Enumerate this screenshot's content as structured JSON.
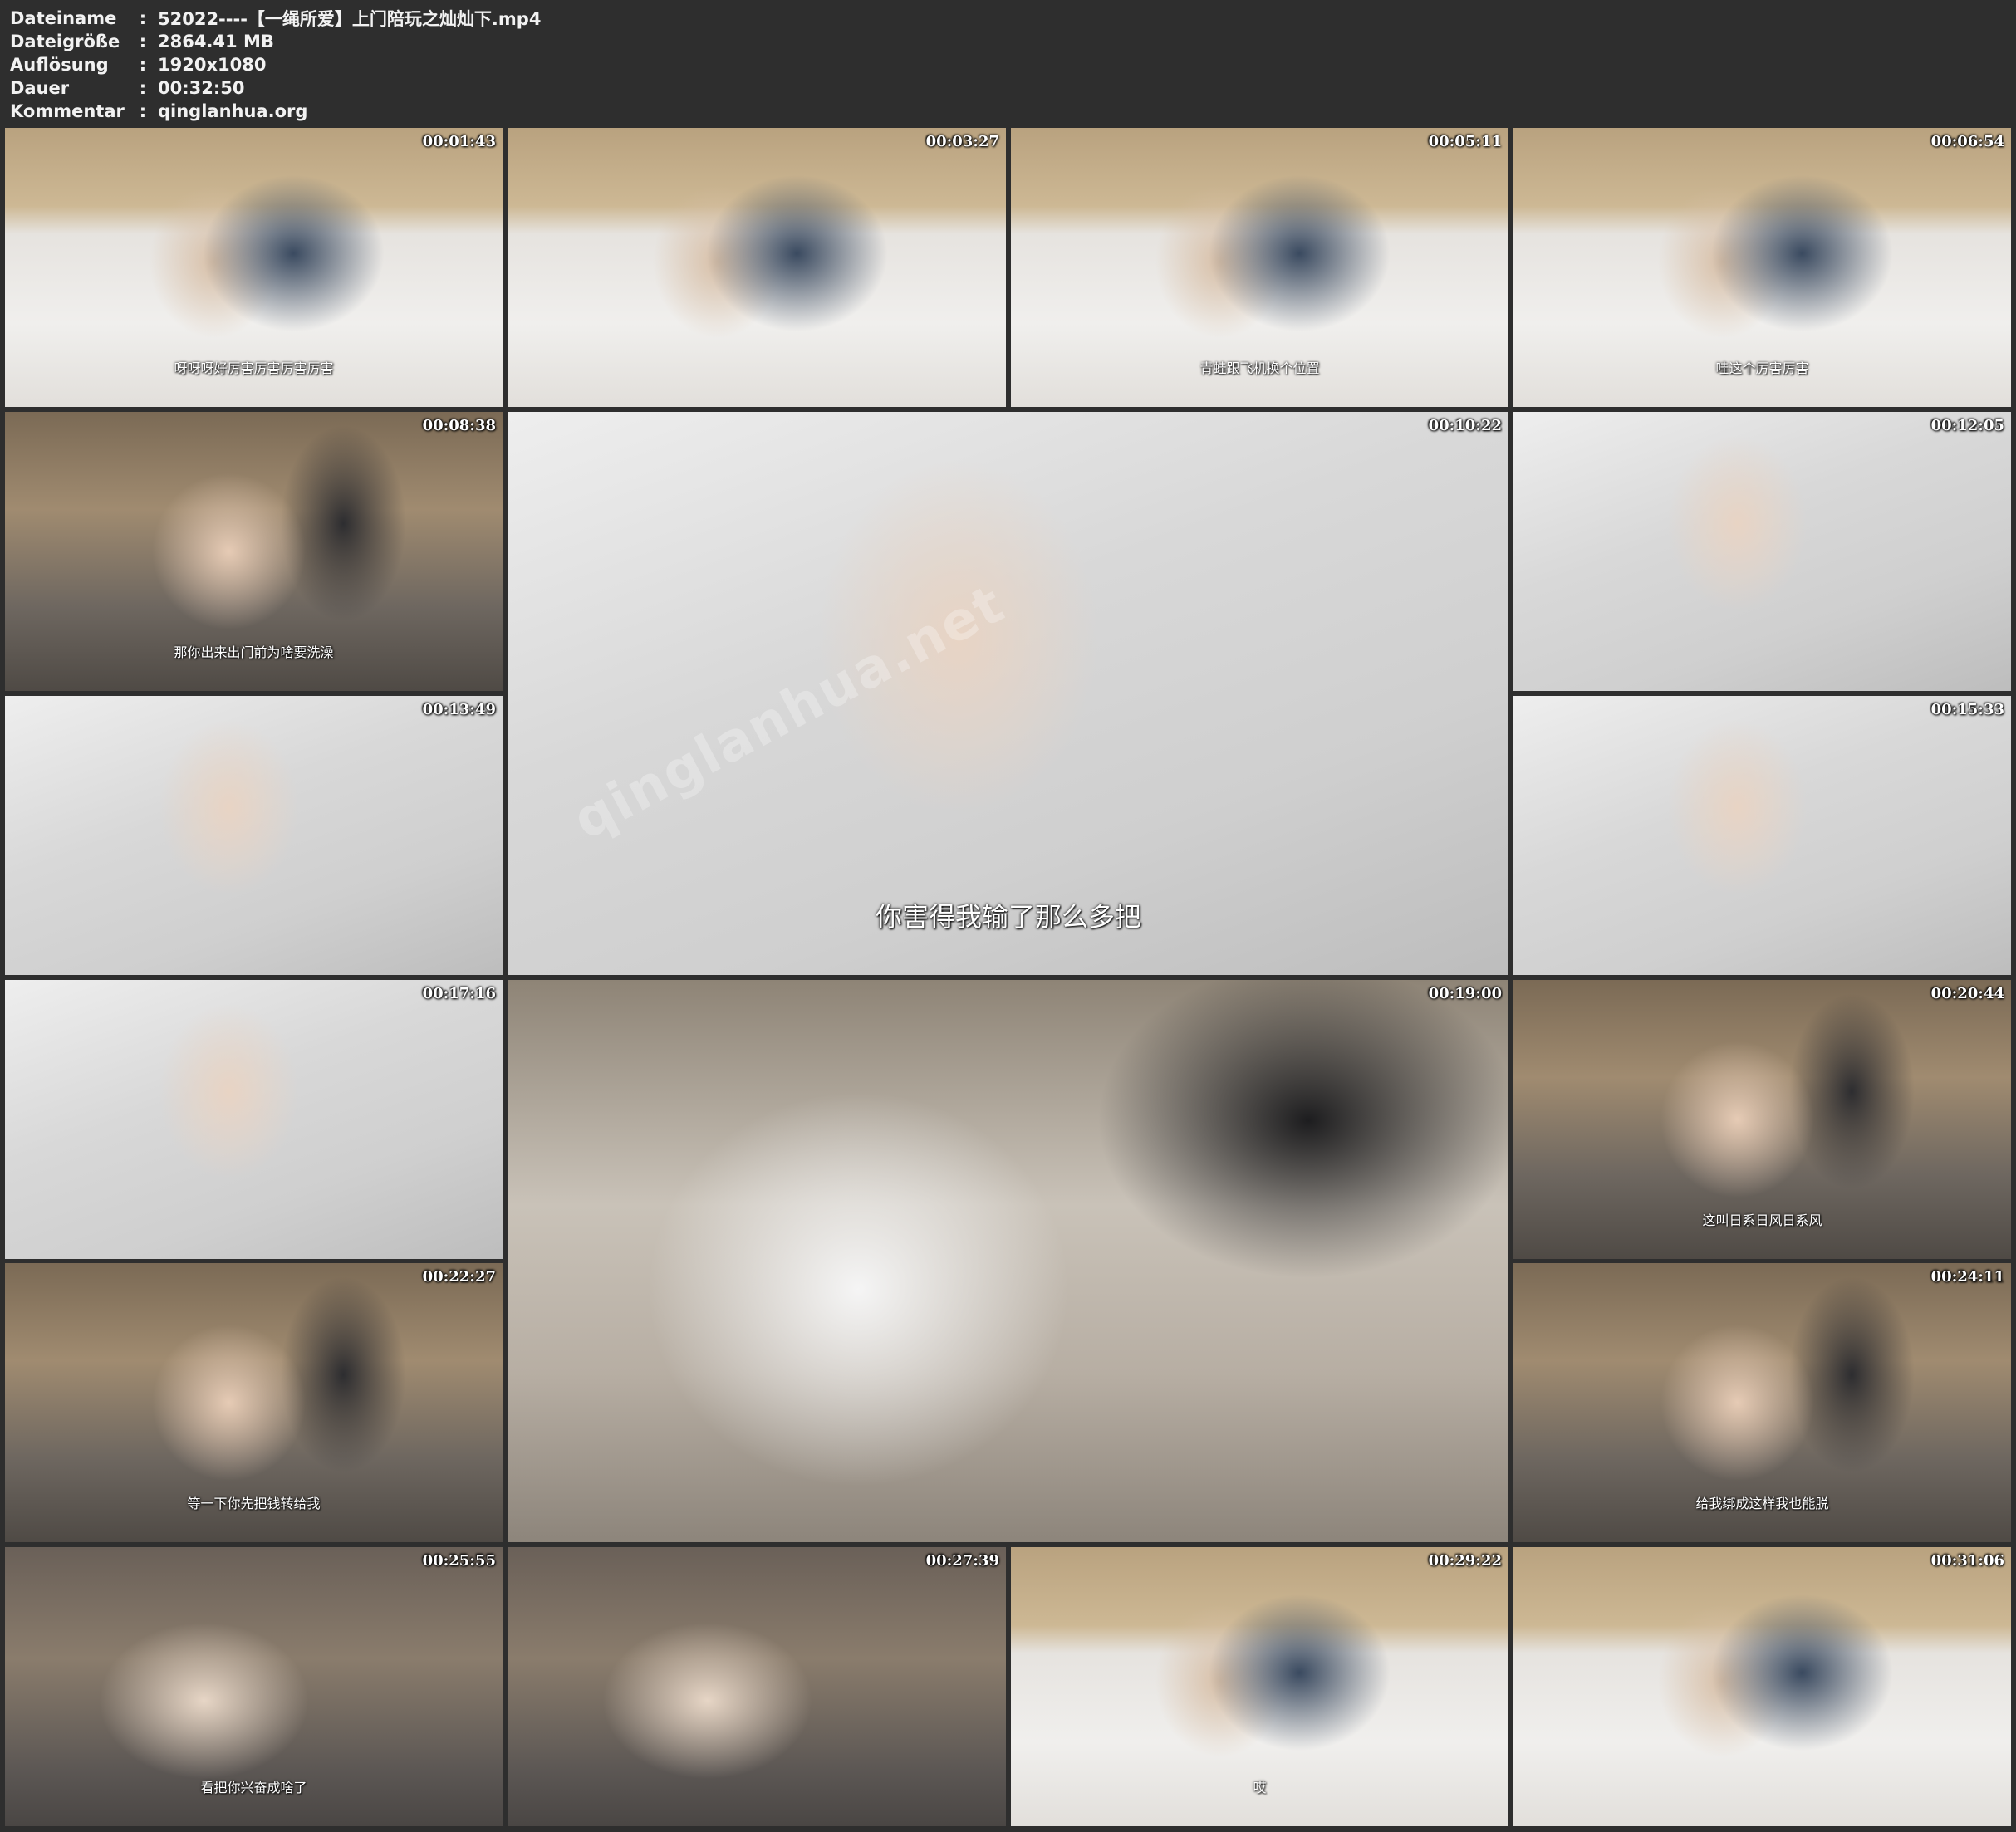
{
  "header": {
    "rows": [
      {
        "label": "Dateiname",
        "value": "52022----【一绳所爱】上门陪玩之灿灿下.mp4"
      },
      {
        "label": "Dateigröße",
        "value": "2864.41 MB"
      },
      {
        "label": "Auflösung",
        "value": "1920x1080"
      },
      {
        "label": "Dauer",
        "value": "00:32:50"
      },
      {
        "label": "Kommentar",
        "value": "qinglanhua.org"
      }
    ],
    "separator": ":"
  },
  "watermark": "qinglanhua.net",
  "thumbnails": [
    {
      "time": "00:01:43",
      "subtitle": "呀呀呀好厉害厉害厉害厉害",
      "scene": "bed"
    },
    {
      "time": "00:03:27",
      "subtitle": "",
      "scene": "bed"
    },
    {
      "time": "00:05:11",
      "subtitle": "青蛙跟飞机换个位置",
      "scene": "bed"
    },
    {
      "time": "00:06:54",
      "subtitle": "哇这个厉害厉害",
      "scene": "bed"
    },
    {
      "time": "00:08:38",
      "subtitle": "那你出来出门前为啥要洗澡",
      "scene": "room"
    },
    {
      "time": "00:10:22",
      "subtitle": "你害得我输了那么多把",
      "scene": "bath"
    },
    {
      "time": "00:12:05",
      "subtitle": "",
      "scene": "bath"
    },
    {
      "time": "00:13:49",
      "subtitle": "",
      "scene": "bath"
    },
    {
      "time": "00:15:33",
      "subtitle": "",
      "scene": "bath"
    },
    {
      "time": "00:17:16",
      "subtitle": "",
      "scene": "bath"
    },
    {
      "time": "00:19:00",
      "subtitle": "",
      "scene": "towel"
    },
    {
      "time": "00:20:44",
      "subtitle": "这叫日系日风日系风",
      "scene": "room"
    },
    {
      "time": "00:22:27",
      "subtitle": "等一下你先把钱转给我",
      "scene": "room"
    },
    {
      "time": "00:24:11",
      "subtitle": "给我绑成这样我也能脱",
      "scene": "room"
    },
    {
      "time": "00:25:55",
      "subtitle": "看把你兴奋成啥了",
      "scene": "floor"
    },
    {
      "time": "00:27:39",
      "subtitle": "",
      "scene": "floor"
    },
    {
      "time": "00:29:22",
      "subtitle": "哎",
      "scene": "bed"
    },
    {
      "time": "00:31:06",
      "subtitle": "",
      "scene": "bed"
    }
  ]
}
